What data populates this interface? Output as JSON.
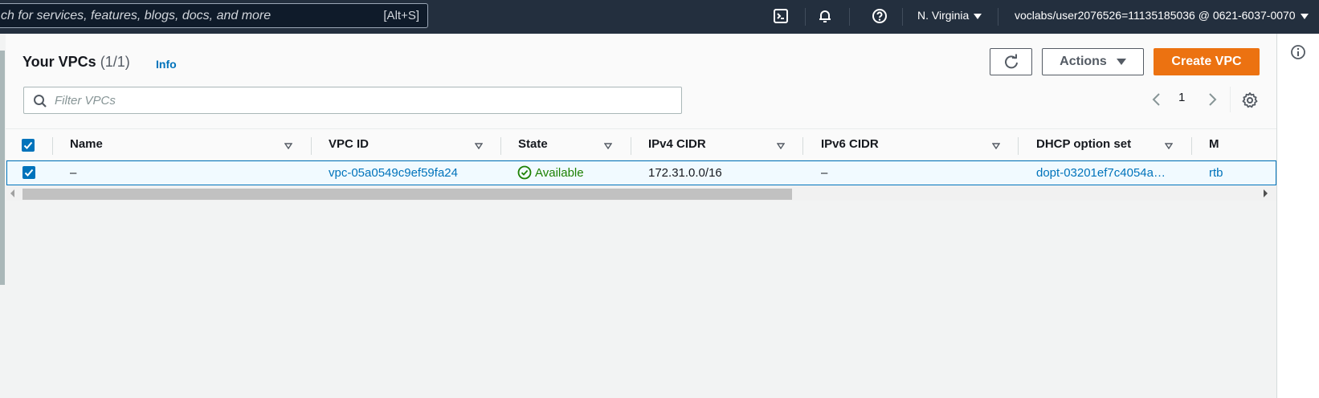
{
  "topbar": {
    "search_text": "ch for services, features, blogs, docs, and more",
    "search_shortcut": "[Alt+S]",
    "icons": [
      "cloudshell-icon",
      "bell-icon",
      "help-icon"
    ],
    "region": "N. Virginia",
    "account": "voclabs/user2076526=11135185036 @ 0621-6037-0070"
  },
  "header": {
    "title": "Your VPCs",
    "count": "(1/1)",
    "info_link": "Info",
    "actions_label": "Actions",
    "create_label": "Create VPC"
  },
  "filter": {
    "placeholder": "Filter VPCs"
  },
  "pagination": {
    "current_page": "1"
  },
  "table": {
    "columns": [
      "Name",
      "VPC ID",
      "State",
      "IPv4 CIDR",
      "IPv6 CIDR",
      "DHCP option set",
      "M"
    ],
    "rows": [
      {
        "selected": true,
        "name": "–",
        "vpc_id": "vpc-05a0549c9ef59fa24",
        "state": "Available",
        "ipv4_cidr": "172.31.0.0/16",
        "ipv6_cidr": "–",
        "dhcp_option_set": "dopt-03201ef7c4054a…",
        "main_route_table": "rtb"
      }
    ]
  },
  "colors": {
    "topbar_bg": "#232f3e",
    "primary_button": "#ec7211",
    "link": "#0073bb",
    "available": "#1d8102"
  }
}
